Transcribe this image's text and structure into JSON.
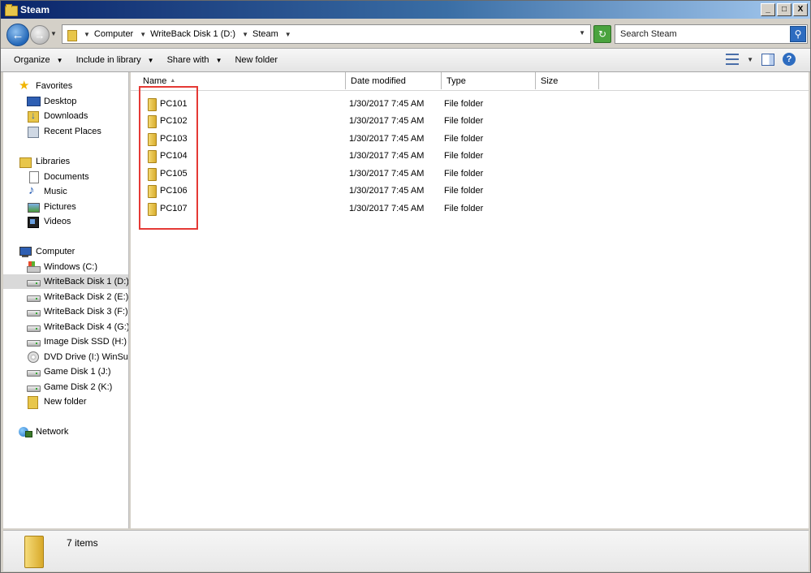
{
  "window": {
    "title": "Steam"
  },
  "title_buttons": {
    "minimize": "_",
    "maximize": "□",
    "close": "X"
  },
  "address": {
    "breadcrumbs": [
      "Computer",
      "WriteBack Disk 1 (D:)",
      "Steam"
    ]
  },
  "search": {
    "placeholder": "Search Steam"
  },
  "toolbar": {
    "organize": "Organize",
    "include_in_library": "Include in library",
    "share_with": "Share with",
    "new_folder": "New folder",
    "help": "?"
  },
  "nav": {
    "favorites": {
      "label": "Favorites",
      "items": [
        "Desktop",
        "Downloads",
        "Recent Places"
      ]
    },
    "libraries": {
      "label": "Libraries",
      "items": [
        "Documents",
        "Music",
        "Pictures",
        "Videos"
      ]
    },
    "computer": {
      "label": "Computer",
      "items": [
        "Windows (C:)",
        "WriteBack Disk 1 (D:)",
        "WriteBack Disk 2 (E:)",
        "WriteBack Disk 3 (F:)",
        "WriteBack Disk 4 (G:)",
        "Image Disk SSD (H:)",
        "DVD Drive (I:) WinSup",
        "Game Disk 1 (J:)",
        "Game Disk 2 (K:)",
        "New folder"
      ],
      "selected": "WriteBack Disk 1 (D:)"
    },
    "network": {
      "label": "Network"
    }
  },
  "columns": {
    "name": "Name",
    "date": "Date modified",
    "type": "Type",
    "size": "Size"
  },
  "files": [
    {
      "name": "PC101",
      "date": "1/30/2017 7:45 AM",
      "type": "File folder"
    },
    {
      "name": "PC102",
      "date": "1/30/2017 7:45 AM",
      "type": "File folder"
    },
    {
      "name": "PC103",
      "date": "1/30/2017 7:45 AM",
      "type": "File folder"
    },
    {
      "name": "PC104",
      "date": "1/30/2017 7:45 AM",
      "type": "File folder"
    },
    {
      "name": "PC105",
      "date": "1/30/2017 7:45 AM",
      "type": "File folder"
    },
    {
      "name": "PC106",
      "date": "1/30/2017 7:45 AM",
      "type": "File folder"
    },
    {
      "name": "PC107",
      "date": "1/30/2017 7:45 AM",
      "type": "File folder"
    }
  ],
  "status": {
    "item_count": "7 items"
  },
  "colors": {
    "highlight_box": "#e53935",
    "selected_nav": "#d9d9d9"
  }
}
